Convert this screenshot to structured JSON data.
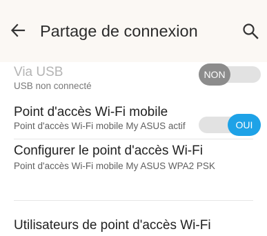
{
  "header": {
    "title": "Partage de connexion",
    "back_icon": "arrow-left-icon",
    "search_icon": "search-icon"
  },
  "settings": [
    {
      "title": "Via USB",
      "summary": "USB non connecté",
      "toggle_label": "NON",
      "toggle_state": "off",
      "enabled": false
    },
    {
      "title": "Point d'accès Wi-Fi mobile",
      "summary": "Point d'accès Wi-Fi mobile My ASUS actif",
      "toggle_label": "OUI",
      "toggle_state": "on",
      "enabled": true
    },
    {
      "title": "Configurer le point d'accès Wi-Fi",
      "summary": "Point d'accès Wi-Fi mobile My ASUS WPA2 PSK"
    },
    {
      "title": "Utilisateurs de point d'accès Wi-Fi"
    }
  ],
  "colors": {
    "accent": "#1ea2e7",
    "toggle_off": "#8c8c8c",
    "header_bg": "#fbf8f4"
  }
}
